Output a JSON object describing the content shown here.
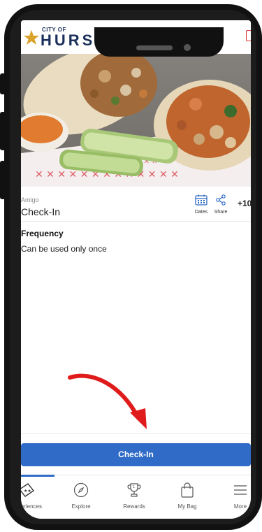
{
  "brand": {
    "small": "CITY OF",
    "big": "HURST"
  },
  "event": {
    "organizer": "Amigo",
    "type": "Check-In",
    "actions": [
      {
        "label": "Dates",
        "icon": "calendar-icon"
      },
      {
        "label": "Share",
        "icon": "share-icon"
      }
    ],
    "points": "+10"
  },
  "frequency": {
    "title": "Frequency",
    "text": "Can be used only once"
  },
  "cta": {
    "label": "Check-In"
  },
  "tabs": [
    {
      "label": "Experiences",
      "icon": "ticket-icon",
      "active": true
    },
    {
      "label": "Explore",
      "icon": "compass-icon"
    },
    {
      "label": "Rewards",
      "icon": "trophy-icon"
    },
    {
      "label": "My Bag",
      "icon": "shopping-bag-icon"
    },
    {
      "label": "More",
      "icon": "menu-icon"
    }
  ],
  "colors": {
    "accent": "#2f6bc7",
    "brand": "#1b2f5b",
    "arrow": "#e01b1b"
  }
}
